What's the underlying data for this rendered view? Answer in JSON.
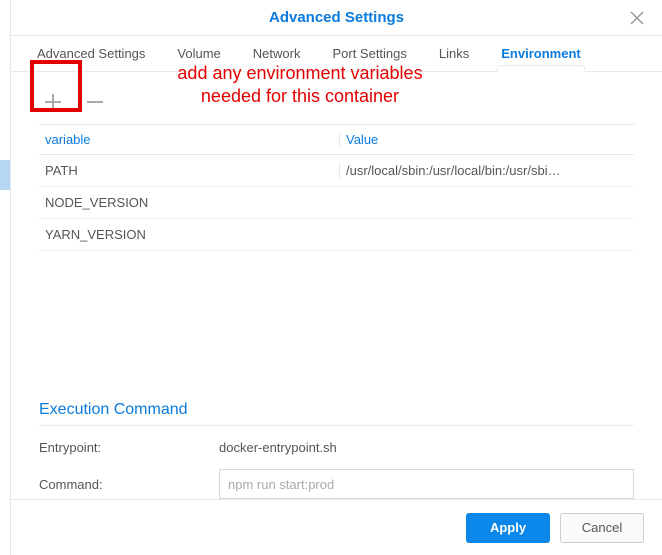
{
  "dialog": {
    "title": "Advanced Settings"
  },
  "tabs": [
    {
      "label": "Advanced Settings"
    },
    {
      "label": "Volume"
    },
    {
      "label": "Network"
    },
    {
      "label": "Port Settings"
    },
    {
      "label": "Links"
    },
    {
      "label": "Environment"
    }
  ],
  "active_tab_index": 5,
  "env_table": {
    "headers": {
      "variable": "variable",
      "value": "Value"
    },
    "rows": [
      {
        "variable": "PATH",
        "value": "/usr/local/sbin:/usr/local/bin:/usr/sbi…"
      },
      {
        "variable": "NODE_VERSION",
        "value": ""
      },
      {
        "variable": "YARN_VERSION",
        "value": ""
      }
    ]
  },
  "exec": {
    "section_title": "Execution Command",
    "entrypoint_label": "Entrypoint:",
    "entrypoint_value": "docker-entrypoint.sh",
    "command_label": "Command:",
    "command_placeholder": "npm run start:prod",
    "command_value": ""
  },
  "buttons": {
    "apply": "Apply",
    "cancel": "Cancel"
  },
  "annotation": {
    "text": "add any environment variables\nneeded for this container"
  }
}
